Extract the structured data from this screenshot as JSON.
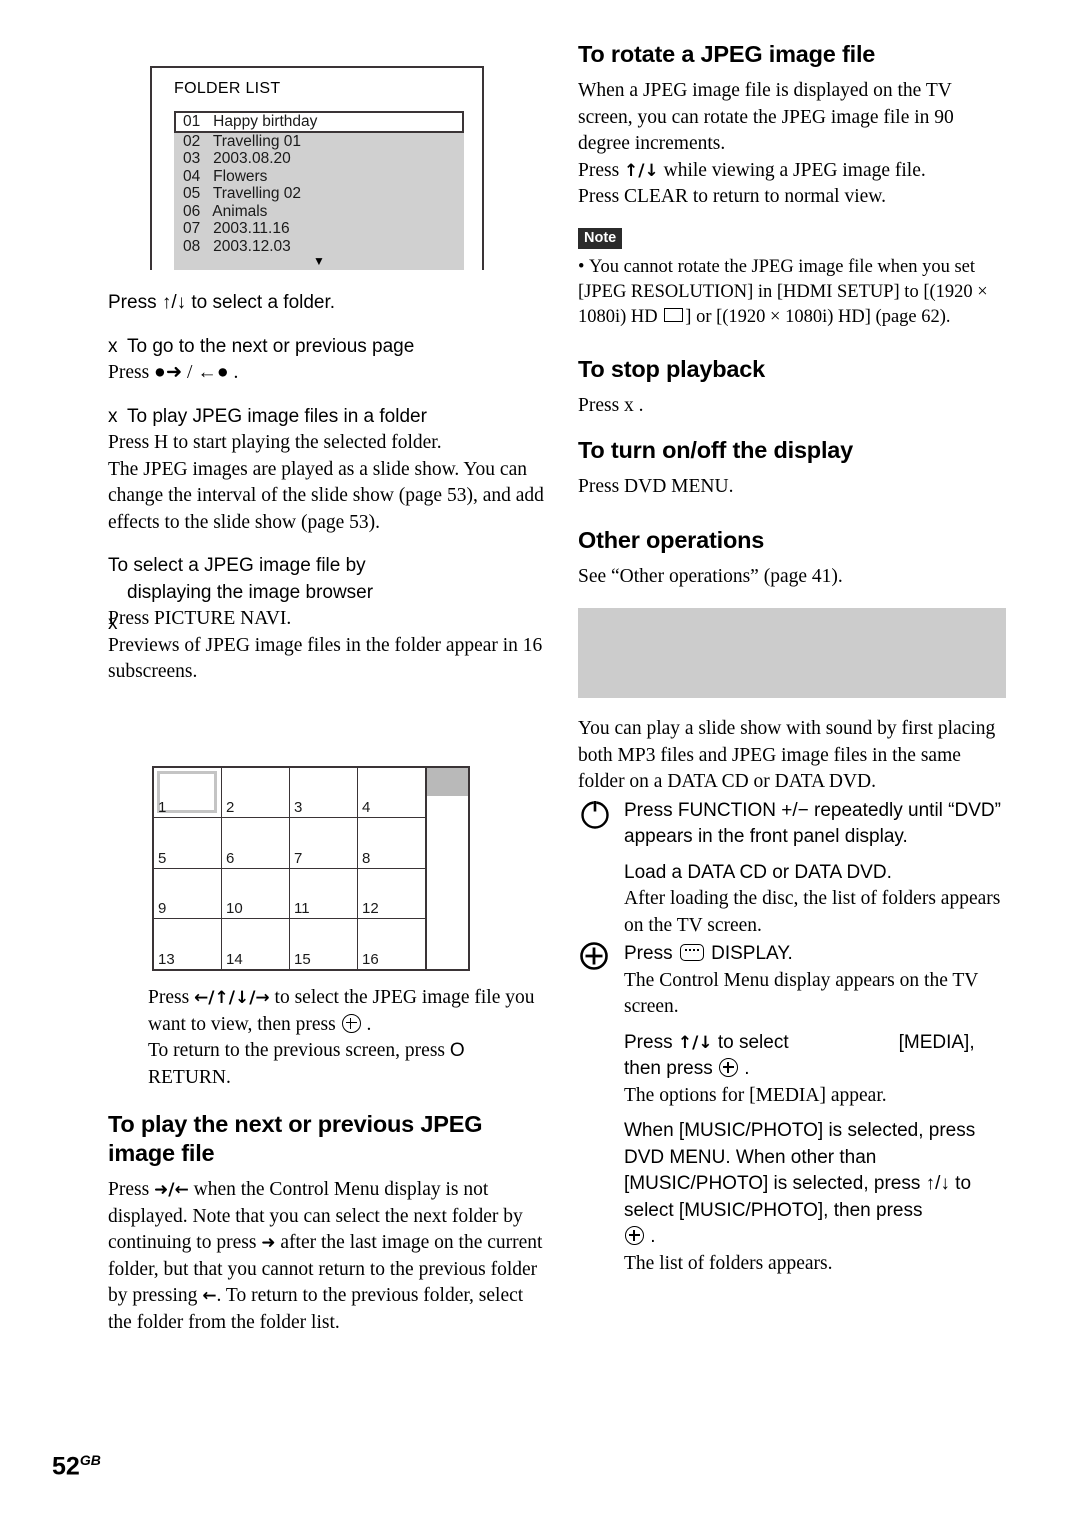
{
  "page": {
    "number": "52",
    "suffix": "GB"
  },
  "tv_screen": {
    "title": "FOLDER LIST",
    "rows": [
      {
        "num": "01",
        "name": "Happy birthday",
        "selected": true
      },
      {
        "num": "02",
        "name": "Travelling 01",
        "selected": false
      },
      {
        "num": "03",
        "name": "2003.08.20",
        "selected": false
      },
      {
        "num": "04",
        "name": "Flowers",
        "selected": false
      },
      {
        "num": "05",
        "name": "Travelling 02",
        "selected": false
      },
      {
        "num": "06",
        "name": "Animals",
        "selected": false
      },
      {
        "num": "07",
        "name": "2003.11.16",
        "selected": false
      },
      {
        "num": "08",
        "name": "2003.12.03",
        "selected": false
      }
    ],
    "scroll_arrow": "▼"
  },
  "left_column": {
    "select_folder_line": "Press ↑/↓ to select a folder.",
    "sub1": {
      "marker": "x",
      "heading": "To go to the next or previous page",
      "body": "Press ●➜ / ←● ."
    },
    "sub2": {
      "marker": "x",
      "heading": "To play JPEG image files in a folder",
      "body": "Press H    to start playing the selected folder.",
      "para": "The JPEG images are played as a slide show. You can change the interval of the slide show (page 53), and add effects to the slide show (page 53)."
    },
    "sub3": {
      "marker": "x",
      "heading_line1": "To select a JPEG image file by",
      "heading_line2": "displaying the image browser",
      "body": "Press PICTURE NAVI.",
      "para": "Previews of JPEG image files in the folder appear in 16 subscreens."
    },
    "grid": {
      "cells": [
        "1",
        "2",
        "3",
        "4",
        "5",
        "6",
        "7",
        "8",
        "9",
        "10",
        "11",
        "12",
        "13",
        "14",
        "15",
        "16"
      ],
      "highlight_cell": "1"
    },
    "after_grid_1_a": "Press ",
    "after_grid_1_arrows": "←/↑/↓/→",
    "after_grid_1_b": " to select the JPEG image file you want to view, then press ",
    "after_grid_1_c": " .",
    "after_grid_2_a": "To return to the previous screen, press ",
    "after_grid_2_o": "O",
    "after_grid_2_b": " RETURN.",
    "heading_next_prev_line1": "To play the next or previous JPEG",
    "heading_next_prev_line2": "image file",
    "next_prev_para_a": "Press ",
    "next_prev_arrows1": "➜/←",
    "next_prev_para_b": " when the Control Menu display is not displayed. Note that you can select the next folder by continuing to press ",
    "next_prev_arrow2": "➜",
    "next_prev_para_c": " after the last image on the current folder, but that you cannot return to the previous folder by pressing ",
    "next_prev_arrow3": "←",
    "next_prev_para_d": ". To return to the previous folder, select the folder from the folder list."
  },
  "right_column": {
    "heading_rotate": "To rotate a JPEG image file",
    "rotate_para": "When a JPEG image file is displayed on the TV screen, you can rotate the JPEG image file in 90 degree increments.",
    "rotate_line2_a": "Press ",
    "rotate_line2_arrows": "↑/↓",
    "rotate_line2_b": " while viewing a JPEG image file.",
    "rotate_line3": "Press CLEAR to return to normal view.",
    "note": {
      "badge": "Note",
      "bullet": "•",
      "text_a": "You cannot rotate the JPEG image file when you set [JPEG RESOLUTION] in [HDMI SETUP] to [(1920 × 1080i) HD ",
      "text_b": "] or [(1920 × 1080i) HD] (page 62)."
    },
    "heading_stop": "To stop playback",
    "stop_body": "Press x .",
    "heading_display": "To turn on/off the display",
    "display_body": "Press DVD MENU.",
    "heading_other": "Other operations",
    "other_body": "See “Other operations” (page 41).",
    "banner_heading": "",
    "intro_para": "You can play a slide show with sound by first placing both MP3 files and JPEG image files in the same folder on a DATA CD or DATA DVD.",
    "steps": [
      {
        "icon": "power-icon",
        "text": "Press FUNCTION +/− repeatedly until “DVD” appears in the front panel display."
      },
      {
        "icon": "none",
        "text": "Load a DATA CD or DATA DVD.",
        "sub": "After loading the disc, the list of folders appears on the TV screen."
      },
      {
        "icon": "plus-circle-icon",
        "text_a": "Press ",
        "text_b": " DISPLAY.",
        "sub": "The Control Menu display appears on the TV screen."
      },
      {
        "icon": "none",
        "text_a": "Press ",
        "text_arrows": "↑/↓",
        "text_b": " to select",
        "text_c": "[MEDIA],",
        "text_d": "then press ",
        "text_e": " .",
        "sub": "The options for [MEDIA] appear."
      },
      {
        "icon": "none",
        "text": "When [MUSIC/PHOTO] is selected, press DVD MENU. When other than [MUSIC/PHOTO] is selected, press ↑/↓ to select [MUSIC/PHOTO], then press",
        "text_end": " .",
        "sub": "The list of folders appears."
      }
    ]
  }
}
